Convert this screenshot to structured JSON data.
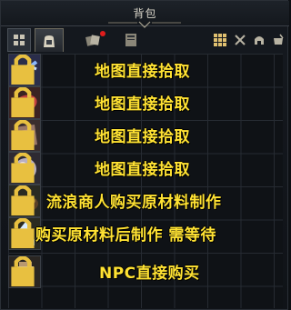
{
  "window": {
    "title": "背包"
  },
  "toolbar": {
    "tabs": [
      "bag-tab",
      "cards-tab",
      "book-tab"
    ],
    "right_icons": [
      "grid-view-icon",
      "crossed-swords-icon",
      "helmet-icon",
      "pot-icon"
    ]
  },
  "items": [
    {
      "icon": "blue-crystal-branch-icon",
      "label": "地图直接拾取"
    },
    {
      "icon": "raw-meat-icon",
      "label": "地图直接拾取"
    },
    {
      "icon": "hide-leather-icon",
      "label": "地图直接拾取"
    },
    {
      "icon": "silver-orb-icon",
      "label": "地图直接拾取"
    },
    {
      "icon": "stew-bowl-icon",
      "label": "流浪商人购买原材料制作"
    },
    {
      "icon": "ice-flask-icon",
      "label": "购买原材料后制作 需等待"
    },
    {
      "icon": "milk-bottle-icon",
      "label": "NPC直接购买"
    }
  ],
  "colors": {
    "label": "#ffe233",
    "notification": "#e01c1c"
  }
}
